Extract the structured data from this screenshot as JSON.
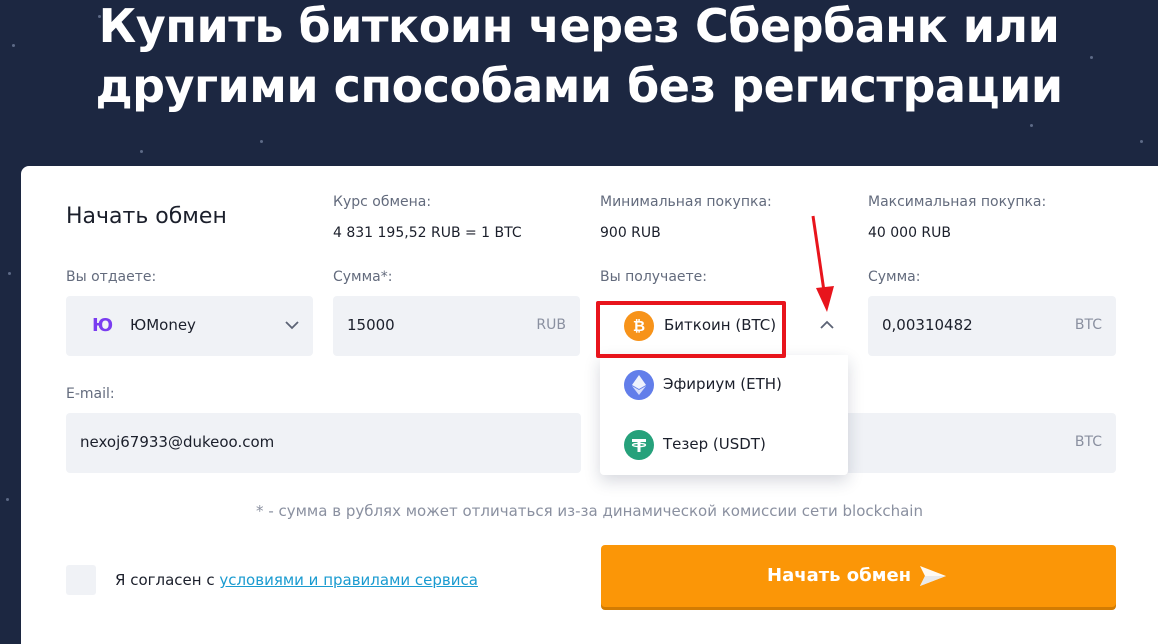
{
  "hero": {
    "title_line1": "Купить биткоин через Сбербанк или",
    "title_line2": "другими способами без регистрации"
  },
  "exchange": {
    "title": "Начать обмен",
    "rate_label": "Курс обмена:",
    "rate_value": "4 831 195,52 RUB = 1 BTC",
    "min_label": "Минимальная покупка:",
    "min_value": "900 RUB",
    "max_label": "Максимальная покупка:",
    "max_value": "40 000 RUB"
  },
  "give": {
    "label": "Вы отдаете:",
    "selected": "ЮMoney",
    "logo_letters": "Ю"
  },
  "give_amount": {
    "label": "Сумма*:",
    "value": "15000",
    "unit": "RUB"
  },
  "receive": {
    "label": "Вы получаете:",
    "selected": "Биткоин (BTC)",
    "options": [
      {
        "label": "Эфириум (ETH)",
        "icon": "ethereum-icon"
      },
      {
        "label": "Тезер (USDT)",
        "icon": "tether-icon"
      }
    ]
  },
  "receive_amount": {
    "label": "Сумма:",
    "value": "0,00310482",
    "unit": "BTC"
  },
  "email": {
    "label": "E-mail:",
    "value": "nexoj67933@dukeoo.com"
  },
  "second_amount": {
    "unit": "BTC"
  },
  "note": "* - сумма в рублях может отличаться из-за динамической комиссии сети blockchain",
  "agreement": {
    "prefix": "Я согласен с ",
    "link": "условиями и правилами сервиса"
  },
  "submit_label": "Начать обмен",
  "colors": {
    "background": "#1c2741",
    "accent": "#fb9607",
    "link": "#1a9bd0",
    "annotation": "#e8141c",
    "bitcoin": "#f7931a",
    "ethereum": "#627eea",
    "tether": "#26a17b"
  }
}
